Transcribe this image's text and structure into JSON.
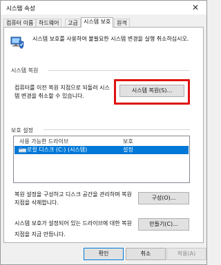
{
  "window": {
    "title": "시스템 속성"
  },
  "tabs": [
    {
      "label": "컴퓨터 이름"
    },
    {
      "label": "하드웨어"
    },
    {
      "label": "고급"
    },
    {
      "label": "시스템 보호"
    },
    {
      "label": "원격"
    }
  ],
  "intro": {
    "text": "시스템 보호를 사용하여 불필요한 시스템 변경을 실행 취소하십시오."
  },
  "restore_section": {
    "heading": "시스템 복원",
    "text": "컴퓨터를 이전 복원 지점으로 되돌려 시스템 변경을 취소할 수 있습니다.",
    "button": "시스템 복원(S)..."
  },
  "protection_section": {
    "heading": "보호 설정",
    "columns": [
      "사용 가능한 드라이브",
      "보호"
    ],
    "rows": [
      {
        "drive": "로컬 디스크 (C:) (시스템)",
        "protection": "설정"
      }
    ],
    "configure_text": "복원 설정을 구성하고 디스크 공간을 관리하며 복원 지점을 삭제합니다.",
    "configure_button": "구성(O)...",
    "create_text": "시스템 보호가 설정되어 있는 드라이브에 대한 복원 지점을 지금 만듭니다.",
    "create_button": "만들기(C)..."
  },
  "footer": {
    "ok": "확인",
    "cancel": "취소",
    "apply": "적용(A)"
  },
  "colors": {
    "highlight": "#e01010",
    "selection": "#0078d7"
  }
}
